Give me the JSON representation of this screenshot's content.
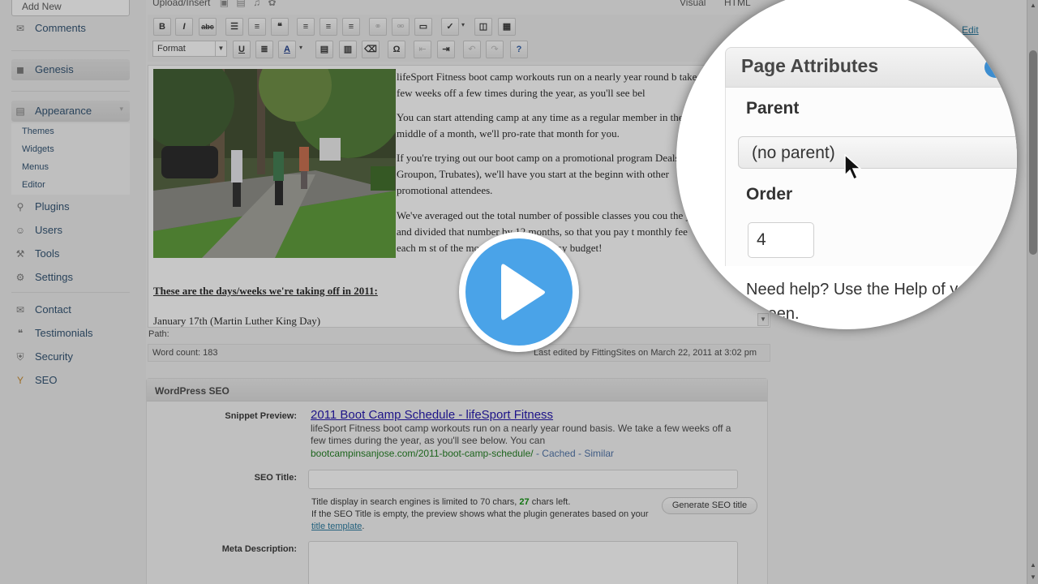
{
  "sidebar": {
    "add_new": "Add New",
    "items": [
      {
        "label": "Comments",
        "icon": "comment-icon"
      },
      {
        "label": "Genesis",
        "icon": "genesis-icon"
      },
      {
        "label": "Appearance",
        "icon": "appearance-icon"
      },
      {
        "label": "Plugins",
        "icon": "plugin-icon"
      },
      {
        "label": "Users",
        "icon": "users-icon"
      },
      {
        "label": "Tools",
        "icon": "tools-icon"
      },
      {
        "label": "Settings",
        "icon": "settings-icon"
      },
      {
        "label": "Contact",
        "icon": "contact-icon"
      },
      {
        "label": "Testimonials",
        "icon": "testimonials-icon"
      },
      {
        "label": "Security",
        "icon": "security-icon"
      },
      {
        "label": "SEO",
        "icon": "seo-icon"
      }
    ],
    "appearance_sub": [
      "Themes",
      "Widgets",
      "Menus",
      "Editor"
    ]
  },
  "editor": {
    "upload_insert": "Upload/Insert",
    "tab_visual": "Visual",
    "tab_html": "HTML",
    "format_label": "Format",
    "paragraphs": [
      "lifeSport Fitness boot camp workouts run on a nearly year round b take a few weeks off a few times during the year, as you'll see bel",
      "You can start attending camp at any time as a regular member in the middle of a month, we'll pro-rate that month for you.",
      "If you're trying out our boot camp on a promotional program Deals, Groupon, Trubates), we'll have you start at the beginn with other promotional attendees.",
      "We've averaged out the total number of possible classes you cou the year and divided that number by 12 months, so that you pay t monthly fee each m   st of the month. Simple and easy budget!"
    ],
    "heading": "These are the days/weeks we're taking off in 2011:",
    "first_line": "January 17th (Martin Luther King Day)",
    "path_label": "Path:",
    "word_count": "Word count: 183",
    "last_edited": "Last edited by FittingSites on March 22, 2011 at 3:02 pm"
  },
  "seo": {
    "header": "WordPress SEO",
    "snippet_label": "Snippet Preview:",
    "snippet_title": "2011 Boot Camp Schedule - lifeSport Fitness",
    "snippet_desc": "lifeSport Fitness boot camp workouts run on a nearly year round basis. We take a few weeks off a few times during the year, as you'll see below. You can",
    "snippet_url": "bootcampinsanjose.com/2011-boot-camp-schedule/",
    "snippet_cached": "Cached",
    "snippet_similar": "Similar",
    "title_label": "SEO Title:",
    "title_help_pre": "Title display in search engines is limited to 70 chars,",
    "title_help_count": "27",
    "title_help_post": "chars left.",
    "title_help_line2": "If the SEO Title is empty, the preview shows what the plugin generates based on your",
    "title_help_link": "title template",
    "generate_button": "Generate SEO title",
    "meta_label": "Meta Description:"
  },
  "right_panel": {
    "edit_link": "Edit"
  },
  "magnifier": {
    "title": "Page Attributes",
    "parent_label": "Parent",
    "parent_value": "(no parent)",
    "order_label": "Order",
    "order_value": "4",
    "help_text": "Need help? Use the Help of your screen."
  },
  "colors": {
    "accent": "#4aa3e8",
    "link": "#21759b",
    "snippet_title": "#1a0dab"
  }
}
